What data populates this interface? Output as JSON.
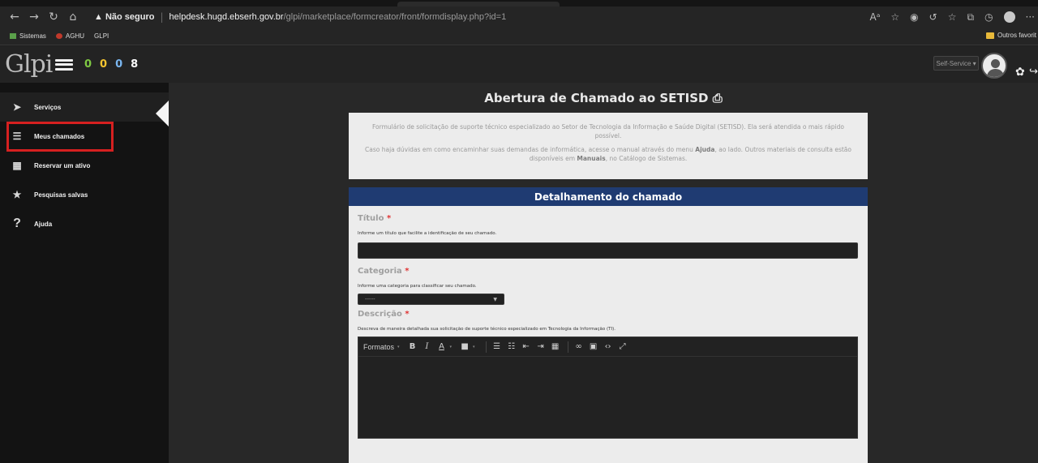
{
  "browser": {
    "security_label": "Não seguro",
    "url_host": "helpdesk.hugd.ebserh.gov.br",
    "url_path": "/glpi/marketplace/formcreator/front/formdisplay.php?id=1",
    "bookmarks": [
      "Sistemas",
      "AGHU",
      "GLPI"
    ],
    "other_favorites": "Outros favorit"
  },
  "app": {
    "logo_text": "Glpi",
    "counters": [
      {
        "value": "0",
        "color": "#7fc943"
      },
      {
        "value": "0",
        "color": "#f4c430"
      },
      {
        "value": "0",
        "color": "#7ab6f0"
      },
      {
        "value": "8",
        "color": "#ffffff"
      }
    ],
    "profile_selector": "Self-Service"
  },
  "sidebar": {
    "items": [
      {
        "label": "Serviços",
        "icon": "paper-plane-icon"
      },
      {
        "label": "Meus chamados",
        "icon": "list-icon"
      },
      {
        "label": "Reservar um ativo",
        "icon": "calendar-icon"
      },
      {
        "label": "Pesquisas salvas",
        "icon": "star-icon"
      },
      {
        "label": "Ajuda",
        "icon": "question-icon"
      }
    ]
  },
  "page": {
    "title": "Abertura de Chamado ao SETISD",
    "intro_line1": "Formulário de solicitação de suporte técnico especializado ao Setor de Tecnologia da Informação e Saúde Digital (SETISD). Ela será atendida o mais rápido possível.",
    "intro_line2_pre": "Caso haja dúvidas em como encaminhar suas demandas de informática, acesse o manual através do menu ",
    "intro_line2_b1": "Ajuda",
    "intro_line2_mid": ", ao lado. Outros materiais de consulta estão disponíveis em ",
    "intro_line2_b2": "Manuais",
    "intro_line2_post": ", no Catálogo de Sistemas."
  },
  "form": {
    "section_title": "Detalhamento do chamado",
    "titulo_label": "Título",
    "titulo_help": "Informe um título que facilite a identificação de seu chamado.",
    "categoria_label": "Categoria",
    "categoria_help": "Informe uma categoria para classificar seu chamado.",
    "categoria_value": "-----",
    "descricao_label": "Descrição",
    "descricao_help": "Descreva de maneira detalhada sua solicitação de suporte técnico especializado em Tecnologia da Informação (TI).",
    "required_mark": "*",
    "toolbar_formats": "Formatos"
  }
}
